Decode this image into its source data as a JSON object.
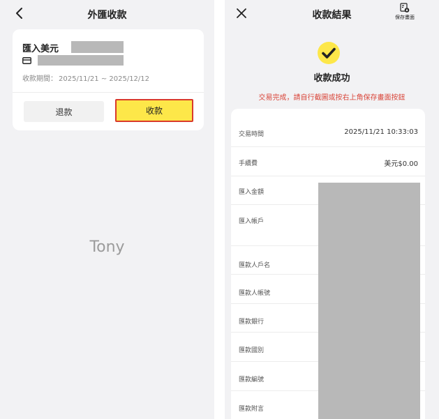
{
  "left_screen": {
    "title": "外匯收款",
    "card": {
      "title": "匯入美元",
      "period_label": "收款期間：",
      "period_value": "2025/11/21 ~ 2025/12/12"
    },
    "buttons": {
      "refund": "退款",
      "collect": "收款"
    },
    "watermark": "Tony"
  },
  "right_screen": {
    "title": "收款結果",
    "save_label": "保存畫面",
    "success_title": "收款成功",
    "hint": "交易完成，請自行截圖或按右上角保存畫面按鈕",
    "rows": [
      {
        "label": "交易時間",
        "value": "2025/11/21 10:33:03"
      },
      {
        "label": "手續費",
        "value": "美元$0.00"
      },
      {
        "label": "匯入金額",
        "value": ""
      },
      {
        "label": "匯入帳戶",
        "value": ""
      },
      {
        "label": "匯款人戶名",
        "value": ""
      },
      {
        "label": "匯款人帳號",
        "value": ""
      },
      {
        "label": "匯款銀行",
        "value": ""
      },
      {
        "label": "匯款國別",
        "value": ""
      },
      {
        "label": "匯款編號",
        "value": ""
      },
      {
        "label": "匯款附言",
        "value": ""
      }
    ]
  },
  "icons": {
    "back": "chevron-left-icon",
    "card": "credit-card-icon",
    "close": "close-icon",
    "save": "save-screen-icon",
    "success": "check-badge-icon"
  },
  "colors": {
    "accent_yellow": "#fde749",
    "highlight_red": "#d93a2b",
    "hint_red": "#d9463a",
    "background": "#f2f2f4"
  }
}
